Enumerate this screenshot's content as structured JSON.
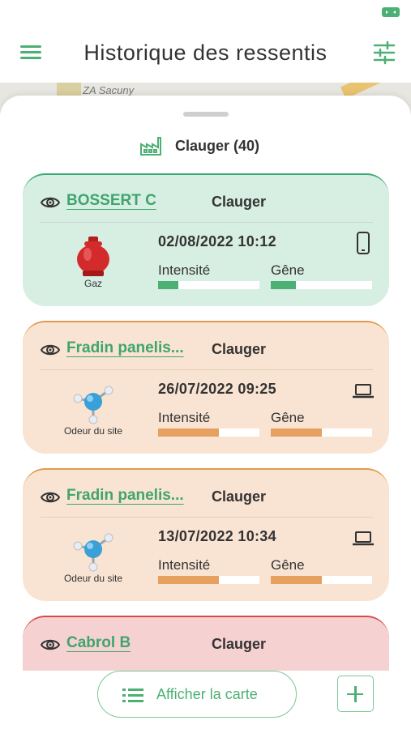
{
  "header": {
    "title": "Historique des ressentis"
  },
  "map": {
    "label": "ZA Sacuny"
  },
  "site": {
    "label": "Clauger (40)"
  },
  "cards": [
    {
      "name": "BOSSERT C",
      "site": "Clauger",
      "type": "Gaz",
      "date": "02/08/2022 10:12",
      "device": "phone-icon",
      "intensite_label": "Intensité",
      "gene_label": "Gêne",
      "intensite": 0.2,
      "gene": 0.25,
      "color": "#4caf73"
    },
    {
      "name": "Fradin panelis...",
      "site": "Clauger",
      "type": "Odeur du site",
      "date": "26/07/2022 09:25",
      "device": "laptop-icon",
      "intensite_label": "Intensité",
      "gene_label": "Gêne",
      "intensite": 0.6,
      "gene": 0.5,
      "color": "#e6a060"
    },
    {
      "name": "Fradin panelis...",
      "site": "Clauger",
      "type": "Odeur du site",
      "date": "13/07/2022 10:34",
      "device": "laptop-icon",
      "intensite_label": "Intensité",
      "gene_label": "Gêne",
      "intensite": 0.6,
      "gene": 0.5,
      "color": "#e6a060"
    },
    {
      "name": "Cabrol B",
      "site": "Clauger",
      "color": "#d84a4a"
    }
  ],
  "bottom": {
    "map_button": "Afficher la carte"
  },
  "colors": {
    "accent": "#4caf73",
    "green_card": "#d7eee3",
    "orange_card": "#f9e4d3",
    "red_card": "#f6d1d1"
  }
}
